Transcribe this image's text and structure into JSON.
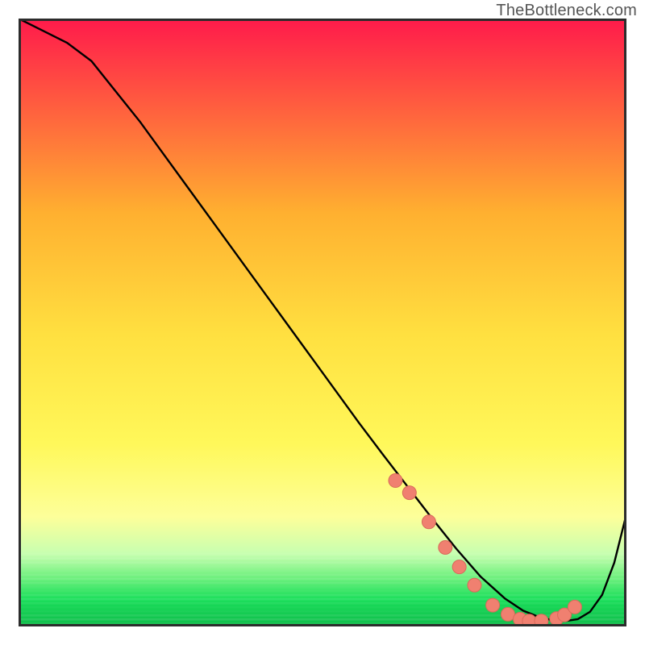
{
  "attribution": "TheBottleneck.com",
  "colors": {
    "curve": "#000000",
    "marker_fill": "#f08070",
    "marker_stroke": "#d86a5a",
    "border": "#2c2c2c",
    "grad_top": "#ff1a4b",
    "grad_mid1": "#ffb030",
    "grad_mid2": "#ffe040",
    "grad_mid3": "#fff85a",
    "grad_yellowpale": "#fdff9a",
    "grad_green_pale": "#c8ffb0",
    "grad_green_mid": "#6cf07c",
    "grad_green": "#1adf5a",
    "grad_green_dark": "#0fbb4a"
  },
  "chart_data": {
    "type": "line",
    "title": "",
    "xlabel": "",
    "ylabel": "",
    "xlim": [
      0,
      100
    ],
    "ylim": [
      0,
      100
    ],
    "x": [
      0,
      4,
      8,
      12,
      16,
      20,
      24,
      28,
      32,
      36,
      40,
      44,
      48,
      52,
      56,
      60,
      64,
      68,
      72,
      76,
      80,
      83,
      86,
      88,
      90,
      92,
      94,
      96,
      98,
      100
    ],
    "values": [
      100,
      98,
      96,
      93,
      88,
      83,
      77.5,
      72,
      66.5,
      61,
      55.5,
      50,
      44.5,
      39,
      33.5,
      28.2,
      23,
      17.8,
      12.8,
      8.2,
      4.6,
      2.6,
      1.4,
      1.0,
      0.9,
      1.2,
      2.4,
      5.2,
      10.5,
      18.5
    ],
    "markers_x": [
      62,
      64.3,
      67.5,
      70.2,
      72.5,
      75,
      78,
      80.5,
      82.5,
      84,
      86,
      88.5,
      89.8,
      91.5
    ],
    "markers_y": [
      24,
      22,
      17.2,
      13,
      9.8,
      6.8,
      3.5,
      2.0,
      1.2,
      0.9,
      0.9,
      1.3,
      1.9,
      3.2
    ],
    "notes": "x and y are abstract 0–100 scales inferred from an unlabeled bottleneck curve; lower y = better (green zone). Markers cluster around the trough."
  }
}
